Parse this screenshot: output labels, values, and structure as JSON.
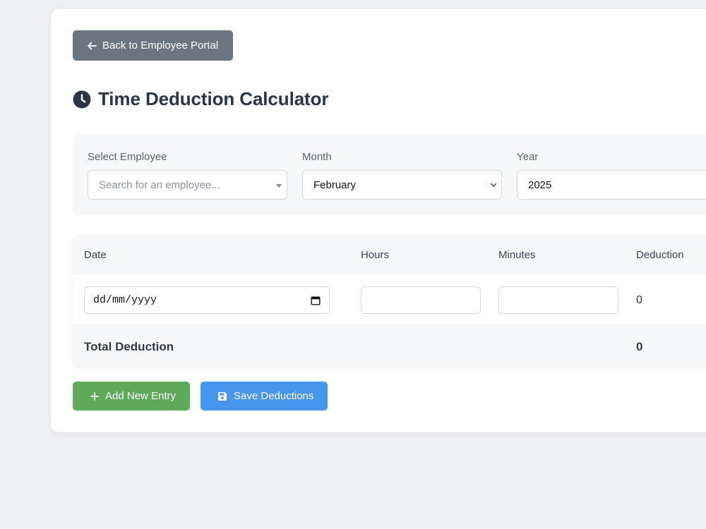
{
  "back_button": {
    "label": "Back to Employee Portal",
    "icon": "arrow-left-icon"
  },
  "page": {
    "title": "Time Deduction Calculator",
    "title_icon": "clock-icon"
  },
  "filters": {
    "employee": {
      "label": "Select Employee",
      "placeholder": "Search for an employee..."
    },
    "month": {
      "label": "Month",
      "value": "February"
    },
    "year": {
      "label": "Year",
      "value": "2025"
    }
  },
  "table": {
    "headers": {
      "date": "Date",
      "hours": "Hours",
      "minutes": "Minutes",
      "deduction": "Deduction"
    },
    "rows": [
      {
        "date_placeholder": "dd/mm/yyyy",
        "hours": "",
        "minutes": "",
        "deduction": "0"
      }
    ],
    "footer": {
      "label": "Total Deduction",
      "total": "0"
    }
  },
  "actions": {
    "add_label": "Add New Entry",
    "add_color": "#5fa95b",
    "save_label": "Save Deductions",
    "save_color": "#4596ec"
  },
  "colors": {
    "back_button": "#6c757d",
    "title": "#2b3544",
    "page_background": "#eff0f4"
  }
}
